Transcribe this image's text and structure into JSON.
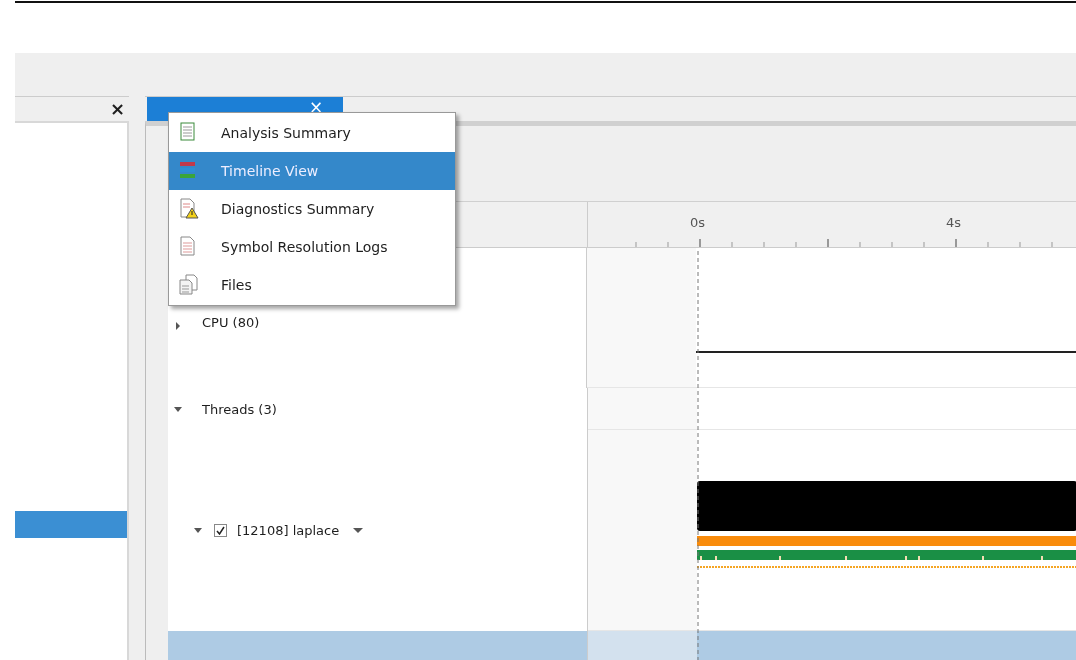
{
  "left_panel": {
    "close": "×",
    "selected_row": true
  },
  "document_tab": {
    "selected": true,
    "close": "×"
  },
  "timeline": {
    "ruler": [
      {
        "label": "0s"
      },
      {
        "label": "4s"
      }
    ],
    "rows": [
      {
        "label": "CPU (80)",
        "kind": "group",
        "expanded": false
      },
      {
        "label": "Threads (3)",
        "kind": "group",
        "expanded": true
      },
      {
        "label": "[12108] laplace",
        "kind": "thread",
        "expanded": true,
        "checked": true
      },
      {
        "kind": "blank",
        "selected": true
      }
    ]
  },
  "view_menu": [
    {
      "label": "Analysis Summary",
      "selected": false
    },
    {
      "label": "Timeline View",
      "selected": true
    },
    {
      "label": "Diagnostics Summary",
      "selected": false
    },
    {
      "label": "Symbol Resolution Logs",
      "selected": false
    },
    {
      "label": "Files",
      "selected": false
    }
  ]
}
